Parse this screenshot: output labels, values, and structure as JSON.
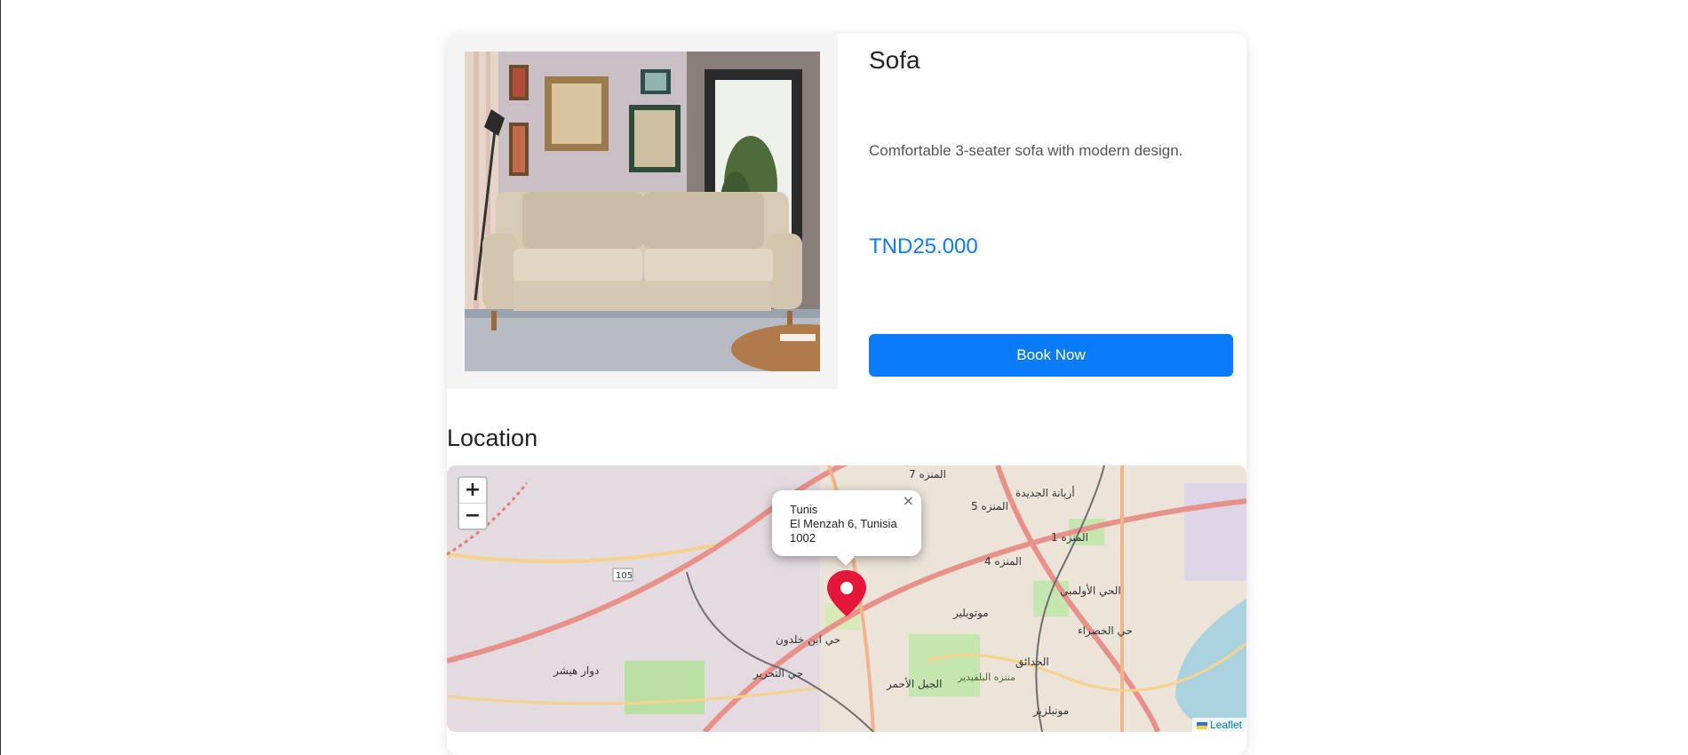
{
  "product": {
    "title": "Sofa",
    "description": "Comfortable 3-seater sofa with modern design.",
    "price": "TND25.000",
    "book_label": "Book Now"
  },
  "location": {
    "heading": "Location"
  },
  "map": {
    "zoom_in": "+",
    "zoom_out": "−",
    "popup": {
      "line1": "Tunis",
      "line2": "El Menzah 6, Tunisia",
      "line3": "1002",
      "close": "×"
    },
    "attribution": "Leaflet",
    "labels": [
      "المنزه 7",
      "المنزه 5",
      "أريانة الجديدة",
      "المنزه 1",
      "المنزه 4",
      "الحي الأولمبي",
      "حي الخضراء",
      "دوار هيشر",
      "حي ابن خلدون",
      "حي التحرير",
      "الجبل الأحمر",
      "منتزه البلفيدير",
      "موتويلير",
      "الحدائق",
      "مونبلزير",
      "105"
    ]
  },
  "colors": {
    "accent": "#0a7cfa",
    "price": "#0d7cf2",
    "marker": "#e4173b"
  }
}
